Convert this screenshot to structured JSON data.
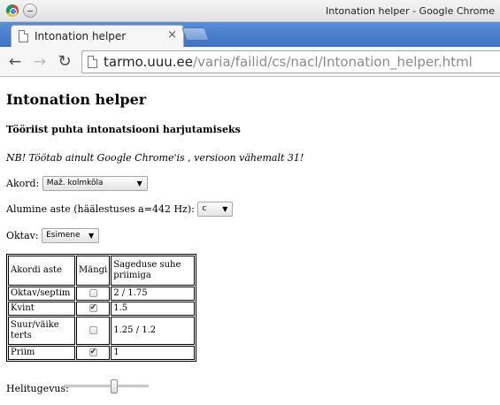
{
  "window": {
    "title": "Intonation helper - Google Chrome"
  },
  "tab": {
    "title": "Intonation helper",
    "close": "×"
  },
  "nav": {
    "back": "←",
    "forward": "→",
    "reload": "↻"
  },
  "omnibox": {
    "host": "tarmo.uuu.ee",
    "path": "/varia/failid/cs/nacl/Intonation_helper.html"
  },
  "page": {
    "title": "Intonation helper",
    "subtitle": "Tööriist puhta intonatsiooni harjutamiseks",
    "note": "NB! Töötab ainult Google Chrome'is , versioon vähemalt 31!",
    "chord": {
      "label": "Akord:",
      "value": "Maž. kolmkõla"
    },
    "base": {
      "label": "Alumine aste (häälestuses a=442 Hz):",
      "value": "c"
    },
    "octave": {
      "label": "Oktav:",
      "value": "Esimene"
    },
    "table": {
      "headers": [
        "Akordi aste",
        "Mängi",
        "Sageduse suhe priimiga"
      ],
      "rows": [
        {
          "degree": "Oktav/septim",
          "play": false,
          "ratio": "2 / 1.75"
        },
        {
          "degree": "Kvint",
          "play": true,
          "ratio": "1.5"
        },
        {
          "degree": "Suur/väike terts",
          "play": false,
          "ratio": "1.25 / 1.2"
        },
        {
          "degree": "Priim",
          "play": true,
          "ratio": "1"
        }
      ]
    },
    "volume": {
      "label": "Helitugevus:",
      "value": 0.6
    }
  },
  "colors": {
    "tabstrip": "#4a80cf",
    "toolbar": "#f6f6f6"
  }
}
